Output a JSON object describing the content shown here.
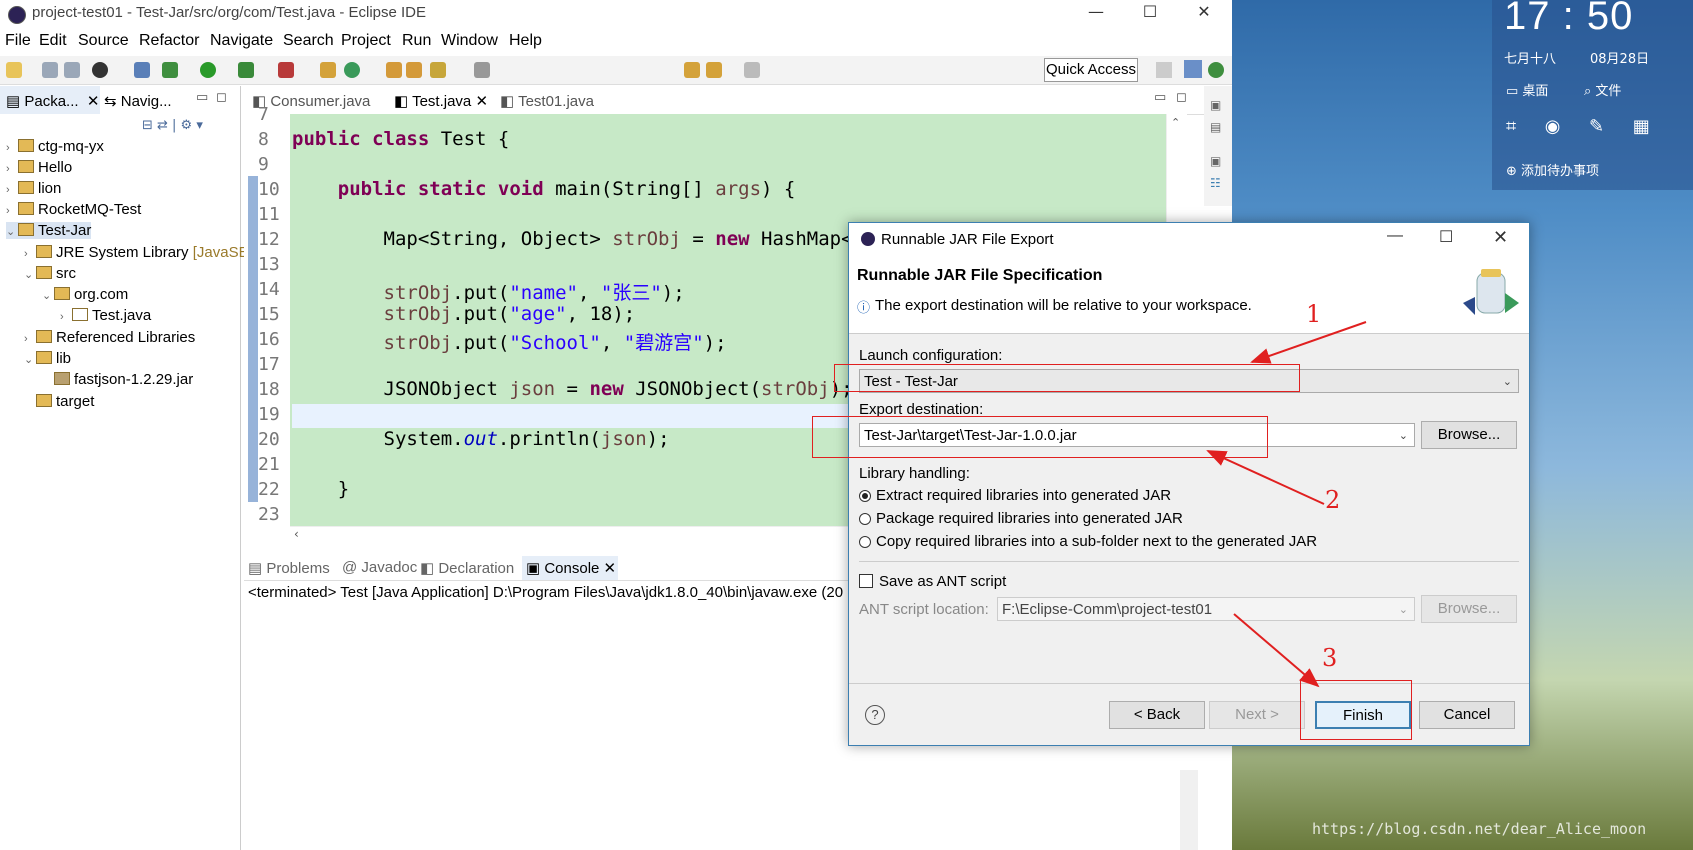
{
  "window": {
    "title": "project-test01 - Test-Jar/src/org/com/Test.java - Eclipse IDE"
  },
  "desktop": {
    "clock_time": "17 : 50",
    "lunar_date": "七月十八",
    "date": "08月28日",
    "buttons": [
      "桌面",
      "文件"
    ],
    "todo_label": "添加待办事项",
    "watermark": "https://blog.csdn.net/dear_Alice_moon"
  },
  "menubar": [
    "File",
    "Edit",
    "Source",
    "Refactor",
    "Navigate",
    "Search",
    "Project",
    "Run",
    "Window",
    "Help"
  ],
  "quick_access": "Quick Access",
  "left_panel": {
    "tabs": [
      "Packa...",
      "Navig..."
    ],
    "tree": [
      {
        "label": "ctg-mq-yx",
        "depth": 0,
        "arrow": "›"
      },
      {
        "label": "Hello",
        "depth": 0,
        "arrow": "›"
      },
      {
        "label": "lion",
        "depth": 0,
        "arrow": "›"
      },
      {
        "label": "RocketMQ-Test",
        "depth": 0,
        "arrow": "›"
      },
      {
        "label": "Test-Jar",
        "depth": 0,
        "arrow": "⌄"
      },
      {
        "label": "JRE System Library",
        "suffix": "[JavaSE",
        "depth": 1,
        "arrow": "›"
      },
      {
        "label": "src",
        "depth": 1,
        "arrow": "⌄"
      },
      {
        "label": "org.com",
        "depth": 2,
        "arrow": "⌄"
      },
      {
        "label": "Test.java",
        "depth": 3,
        "arrow": "›"
      },
      {
        "label": "Referenced Libraries",
        "depth": 1,
        "arrow": "›"
      },
      {
        "label": "lib",
        "depth": 1,
        "arrow": "⌄"
      },
      {
        "label": "fastjson-1.2.29.jar",
        "depth": 2,
        "arrow": ""
      },
      {
        "label": "target",
        "depth": 1,
        "arrow": ""
      }
    ]
  },
  "editor": {
    "tabs": [
      "Consumer.java",
      "Test.java",
      "Test01.java"
    ],
    "line_numbers": [
      "7",
      "8",
      "9",
      "10",
      "11",
      "12",
      "13",
      "14",
      "15",
      "16",
      "17",
      "18",
      "19",
      "20",
      "21",
      "22",
      "23"
    ]
  },
  "console": {
    "tabs": [
      "Problems",
      "Javadoc",
      "Declaration",
      "Console"
    ],
    "output": "<terminated> Test [Java Application] D:\\Program Files\\Java\\jdk1.8.0_40\\bin\\javaw.exe (20"
  },
  "dialog": {
    "title": "Runnable JAR File Export",
    "heading": "Runnable JAR File Specification",
    "info": "The export destination will be relative to your workspace.",
    "launch_label": "Launch configuration:",
    "launch_value": "Test - Test-Jar",
    "export_label": "Export destination:",
    "export_value": "Test-Jar\\target\\Test-Jar-1.0.0.jar",
    "browse": "Browse...",
    "library_label": "Library handling:",
    "options": [
      "Extract required libraries into generated JAR",
      "Package required libraries into generated JAR",
      "Copy required libraries into a sub-folder next to the generated JAR"
    ],
    "ant_checkbox": "Save as ANT script",
    "ant_label": "ANT script location:",
    "ant_value": "F:\\Eclipse-Comm\\project-test01",
    "back": "< Back",
    "next": "Next >",
    "finish": "Finish",
    "cancel": "Cancel",
    "help": "?"
  },
  "annotations": [
    "1",
    "2",
    "3"
  ]
}
